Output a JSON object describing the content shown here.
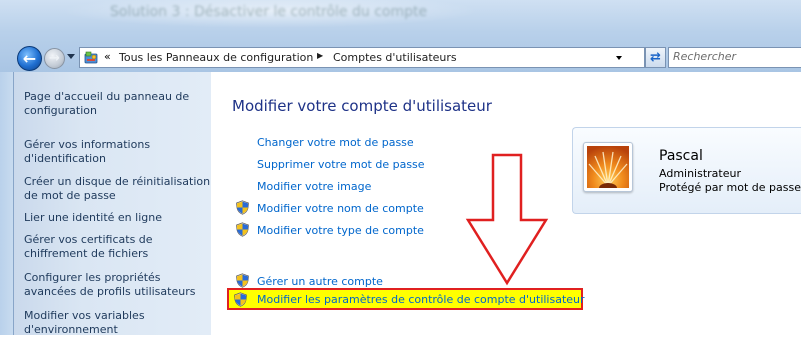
{
  "window": {
    "title": "Solution 3 : Désactiver le contrôle du compte"
  },
  "address_bar": {
    "overflow_chevron": "«",
    "crumbs": [
      "Tous les Panneaux de configuration",
      "Comptes d'utilisateurs"
    ],
    "separator": "▶"
  },
  "search": {
    "placeholder": "Rechercher"
  },
  "left_pane": {
    "items": [
      "Page d'accueil du panneau de configuration",
      "Gérer vos informations d'identification",
      "Créer un disque de réinitialisation de mot de passe",
      "Lier une identité en ligne",
      "Gérer vos certificats de chiffrement de fichiers",
      "Configurer les propriétés avancées de profils utilisateurs",
      "Modifier vos variables d'environnement"
    ]
  },
  "main": {
    "heading": "Modifier votre compte d'utilisateur",
    "links": [
      "Changer votre mot de passe",
      "Supprimer votre mot de passe",
      "Modifier votre image",
      "Modifier votre nom de compte",
      "Modifier votre type de compte"
    ],
    "other_links": [
      "Gérer un autre compte",
      "Modifier les paramètres de contrôle de compte d'utilisateur"
    ]
  },
  "user": {
    "name": "Pascal",
    "role": "Administrateur",
    "status": "Protégé par mot de passe"
  },
  "annotation": {
    "highlight_color": "#ffff00",
    "arrow_color": "#e02020"
  }
}
